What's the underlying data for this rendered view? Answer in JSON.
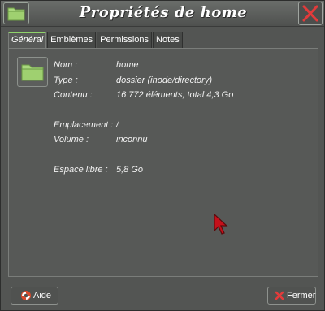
{
  "window": {
    "title": "Propriétés de home",
    "folder_icon": "folder-icon",
    "close_icon": "close-x-icon",
    "accent_color": "#8fd36a",
    "close_color": "#e23b3b"
  },
  "tabs": [
    {
      "label": "Général",
      "active": true
    },
    {
      "label": "Emblèmes",
      "active": false
    },
    {
      "label": "Permissions",
      "active": false
    },
    {
      "label": "Notes",
      "active": false
    }
  ],
  "properties": {
    "name_label": "Nom :",
    "name_value": "home",
    "type_label": "Type :",
    "type_value": "dossier (inode/directory)",
    "content_label": "Contenu :",
    "content_value": "16 772 éléments, total 4,3 Go",
    "location_label": "Emplacement :",
    "location_value": "/",
    "volume_label": "Volume :",
    "volume_value": "inconnu",
    "free_label": "Espace libre :",
    "free_value": "5,8 Go"
  },
  "buttons": {
    "help_label": "Aide",
    "help_icon": "lifebuoy-icon",
    "close_label": "Fermer",
    "close_icon": "red-x-icon"
  }
}
